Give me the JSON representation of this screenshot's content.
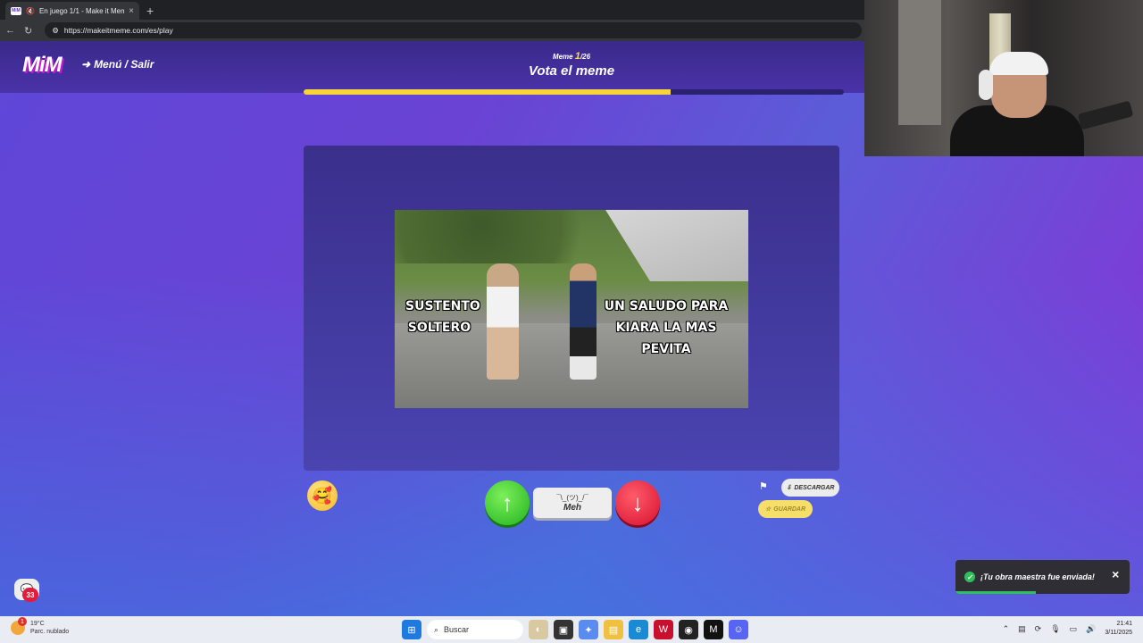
{
  "browser": {
    "tab_favicon": "MiM",
    "tab_title": "En juego 1/1 - Make it Meme",
    "tab_close": "×",
    "new_tab": "+",
    "url": "https://makeitmeme.com/es/play"
  },
  "header": {
    "logo": "MiM",
    "menu_label": "Menú / Salir",
    "counter_prefix": "Meme",
    "counter_current": "1",
    "counter_total": "/26",
    "title": "Vota el meme",
    "progress": 0.68
  },
  "meme": {
    "caption_left": "SUSTENTO SOLTERO",
    "caption_right": "UN SALUDO PARA KIARA LA MAS PEVITA"
  },
  "controls": {
    "emoji": "🥰",
    "upvote_icon": "arrow-up-icon",
    "downvote_icon": "arrow-down-icon",
    "meh_face": "¯\\_(ツ)_/¯",
    "meh_label": "Meh",
    "download_label": "DESCARGAR",
    "save_label": "GUARDAR"
  },
  "chat": {
    "badge": "33"
  },
  "toast": {
    "message": "¡Tu obra maestra fue enviada!",
    "close": "×"
  },
  "taskbar": {
    "weather_temp": "19°C",
    "weather_desc": "Parc. nublado",
    "weather_alert": "1",
    "search_placeholder": "Buscar",
    "time": "21:41",
    "date": "3/11/2025"
  }
}
